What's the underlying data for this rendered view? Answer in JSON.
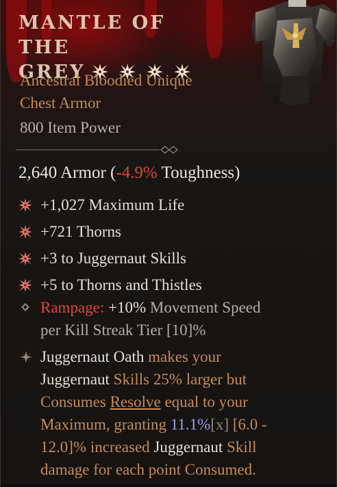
{
  "item": {
    "name_line1": "MANTLE OF THE",
    "name_line2": "GREY",
    "rarity": "Ancestral Bloodied Unique",
    "slot": "Chest Armor",
    "item_power": "800 Item Power",
    "icon": "chest-armor-icon"
  },
  "armor": {
    "value": "2,640 Armor (",
    "toughness_delta": "-4.9%",
    "toughness_suffix": " Toughness)"
  },
  "affixes": [
    {
      "text": "+1,027 Maximum Life",
      "icon": "unique-affix-icon"
    },
    {
      "text": "+721 Thorns",
      "icon": "unique-affix-icon"
    },
    {
      "text": "+3 to Juggernaut Skills",
      "icon": "unique-affix-icon"
    },
    {
      "text": "+5 to Thorns and Thistles",
      "icon": "unique-affix-icon"
    }
  ],
  "rampage": {
    "label": "Rampage:",
    "value": " +10%",
    "stat": " Movement Speed",
    "line2": "per Kill Streak Tier [10]%"
  },
  "oath": {
    "p1": "Juggernaut Oath",
    "p2": " makes your",
    "p3": "Juggernaut",
    "p4": " Skills 25% larger but",
    "p5": "Consumes ",
    "p6": "Resolve",
    "p7": " equal to your",
    "p8": "Maximum, granting ",
    "p9": "11.1%",
    "p10": "[x]",
    "p11": " [6.0 -",
    "p12": "12.0]% increased ",
    "p13": "Juggernaut",
    "p14": " Skill",
    "p15": "damage for each point Consumed."
  },
  "colors": {
    "title": "#dcc6ae",
    "unique_orange": "#c68b5a",
    "negative_red": "#e0463a",
    "roll_blue": "#9d9ff5",
    "blood_red": "#960a0c"
  }
}
